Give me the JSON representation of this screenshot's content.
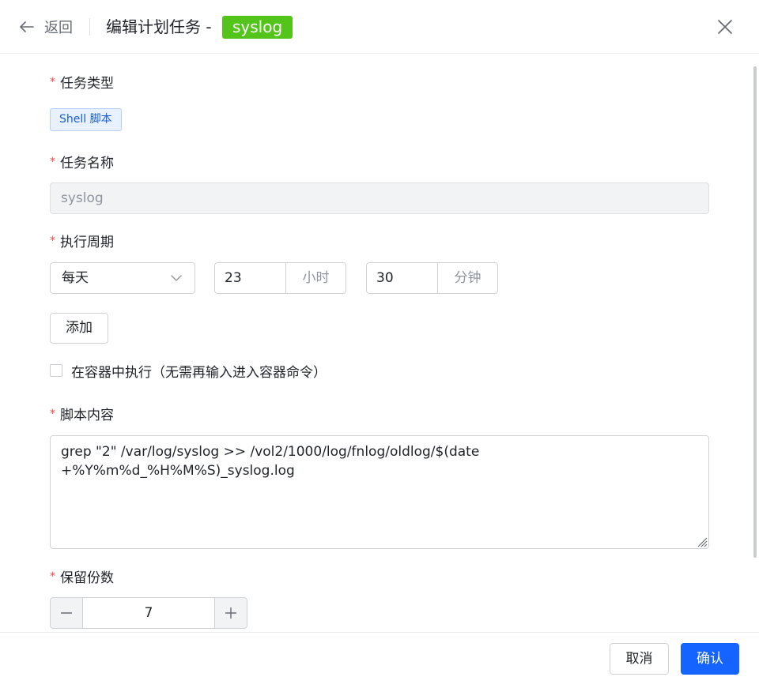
{
  "header": {
    "back_label": "返回",
    "title": "编辑计划任务 -",
    "badge": "syslog"
  },
  "form": {
    "task_type": {
      "label": "任务类型",
      "tag": "Shell 脚本"
    },
    "task_name": {
      "label": "任务名称",
      "value": "syslog"
    },
    "schedule": {
      "label": "执行周期",
      "frequency": "每天",
      "hour_value": "23",
      "hour_unit": "小时",
      "minute_value": "30",
      "minute_unit": "分钟",
      "add_label": "添加"
    },
    "container_option": {
      "label": "在容器中执行（无需再输入进入容器命令）",
      "checked": false
    },
    "script": {
      "label": "脚本内容",
      "value": "grep \"2\" /var/log/syslog >> /vol2/1000/log/fnlog/oldlog/$(date +%Y%m%d_%H%M%S)_syslog.log"
    },
    "retention": {
      "label": "保留份数",
      "value": "7"
    }
  },
  "footer": {
    "cancel_label": "取消",
    "confirm_label": "确认"
  },
  "colors": {
    "badge_bg": "#52c41a",
    "primary": "#1664ff",
    "required": "#f54a45",
    "tag_text": "#1a5fd1"
  }
}
